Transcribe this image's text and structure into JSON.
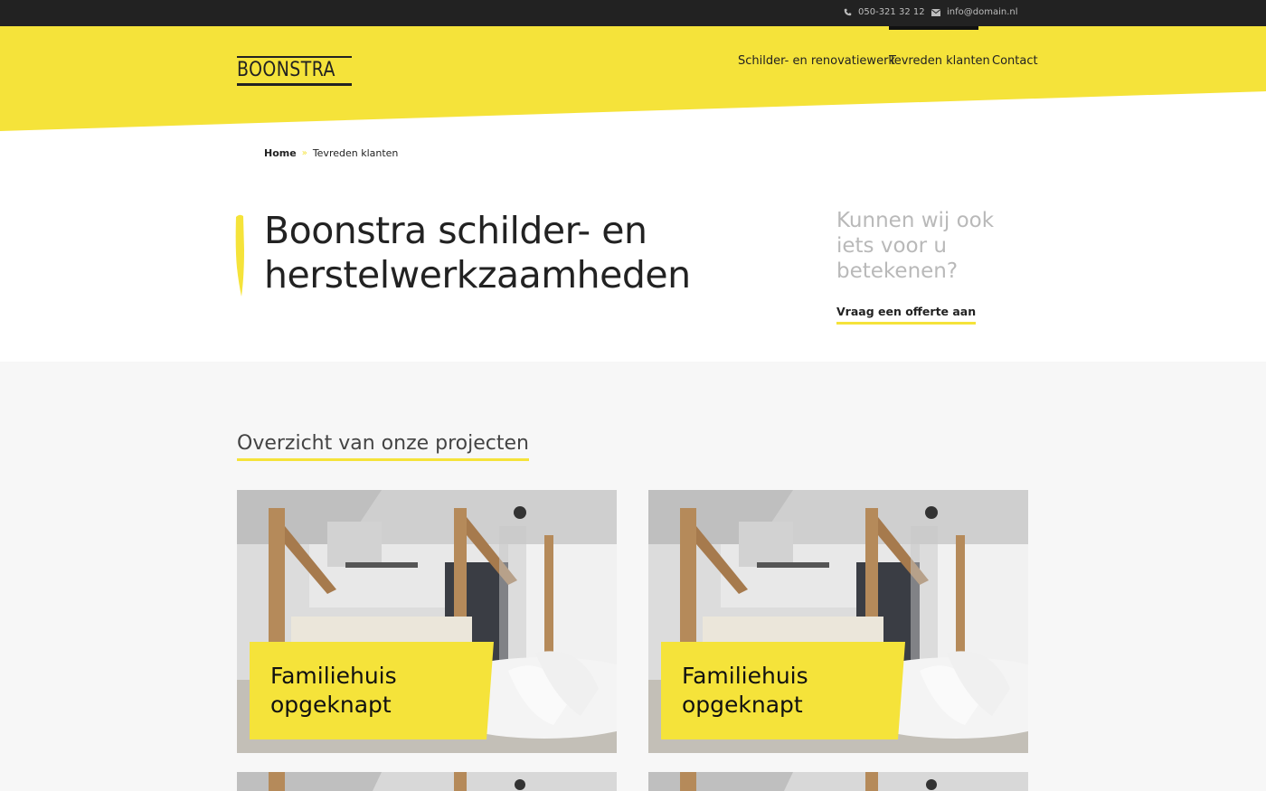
{
  "topbar": {
    "phone": "050-321 32 12",
    "email": "info@domain.nl",
    "phone_icon": "phone-icon",
    "email_icon": "envelope-icon"
  },
  "brand": {
    "logo_text": "BOONSTRA",
    "accent_color": "#f5e33a",
    "dark_color": "#222222"
  },
  "nav": {
    "items": [
      {
        "label": "Schilder- en renovatiewerk",
        "active": false
      },
      {
        "label": "Tevreden klanten",
        "active": true
      },
      {
        "label": "Contact",
        "active": false
      }
    ]
  },
  "breadcrumb": {
    "home": "Home",
    "separator": "»",
    "current": "Tevreden klanten"
  },
  "hero": {
    "title_line1": "Boonstra schilder- en",
    "title_line2": "herstelwerkzaamheden",
    "cta_heading": "Kunnen wij ook iets voor u betekenen?",
    "cta_link": "Vraag een offerte aan"
  },
  "projects": {
    "section_title": "Overzicht van onze projecten",
    "cards": [
      {
        "title": "Familiehuis opgeknapt"
      },
      {
        "title": "Familiehuis opgeknapt"
      },
      {
        "title": ""
      },
      {
        "title": ""
      }
    ]
  }
}
